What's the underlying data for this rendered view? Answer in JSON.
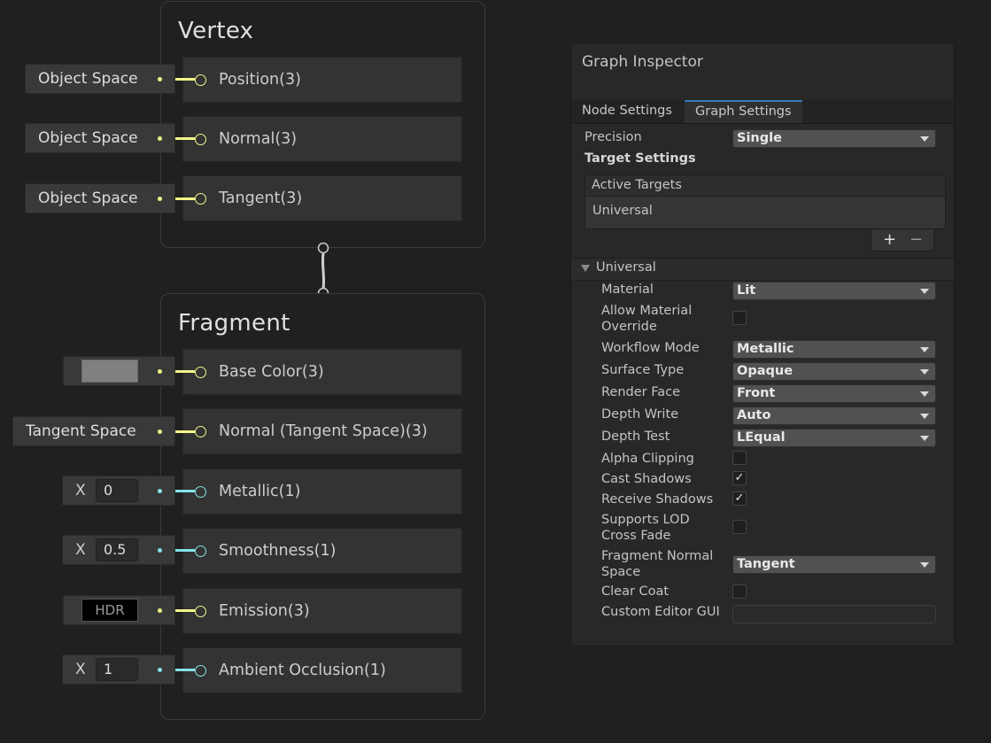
{
  "vertex": {
    "title": "Vertex",
    "ports": [
      {
        "label": "Position(3)",
        "input": "Object Space"
      },
      {
        "label": "Normal(3)",
        "input": "Object Space"
      },
      {
        "label": "Tangent(3)",
        "input": "Object Space"
      }
    ]
  },
  "fragment": {
    "title": "Fragment",
    "ports": [
      {
        "label": "Base Color(3)",
        "input_type": "color",
        "color": "#808080"
      },
      {
        "label": "Normal (Tangent Space)(3)",
        "input": "Tangent Space"
      },
      {
        "label": "Metallic(1)",
        "axis": "X",
        "value": "0"
      },
      {
        "label": "Smoothness(1)",
        "axis": "X",
        "value": "0.5"
      },
      {
        "label": "Emission(3)",
        "input": "HDR"
      },
      {
        "label": "Ambient Occlusion(1)",
        "axis": "X",
        "value": "1"
      }
    ]
  },
  "inspector": {
    "title": "Graph Inspector",
    "tabs": [
      {
        "label": "Node Settings",
        "active": false
      },
      {
        "label": "Graph Settings",
        "active": true
      }
    ],
    "precision_label": "Precision",
    "precision_value": "Single",
    "target_settings_label": "Target Settings",
    "active_targets_header": "Active Targets",
    "active_targets": [
      "Universal"
    ],
    "add_symbol": "+",
    "remove_symbol": "−",
    "foldout_label": "Universal",
    "properties": [
      {
        "label": "Material",
        "kind": "dropdown",
        "value": "Lit"
      },
      {
        "label": "Allow Material Override",
        "kind": "checkbox",
        "checked": false
      },
      {
        "label": "Workflow Mode",
        "kind": "dropdown",
        "value": "Metallic"
      },
      {
        "label": "Surface Type",
        "kind": "dropdown",
        "value": "Opaque"
      },
      {
        "label": "Render Face",
        "kind": "dropdown",
        "value": "Front"
      },
      {
        "label": "Depth Write",
        "kind": "dropdown",
        "value": "Auto"
      },
      {
        "label": "Depth Test",
        "kind": "dropdown",
        "value": "LEqual"
      },
      {
        "label": "Alpha Clipping",
        "kind": "checkbox",
        "checked": false
      },
      {
        "label": "Cast Shadows",
        "kind": "checkbox",
        "checked": true
      },
      {
        "label": "Receive Shadows",
        "kind": "checkbox",
        "checked": true
      },
      {
        "label": "Supports LOD Cross Fade",
        "kind": "checkbox",
        "checked": false
      },
      {
        "label": "Fragment Normal Space",
        "kind": "dropdown",
        "value": "Tangent"
      },
      {
        "label": "Clear Coat",
        "kind": "checkbox",
        "checked": false
      },
      {
        "label": "Custom Editor GUI",
        "kind": "text",
        "value": ""
      }
    ],
    "check_glyph": "✓"
  },
  "colors": {
    "vector3_port": "#f2f58a",
    "float_port": "#84e4e7",
    "tab_accent": "#3a79bb"
  }
}
